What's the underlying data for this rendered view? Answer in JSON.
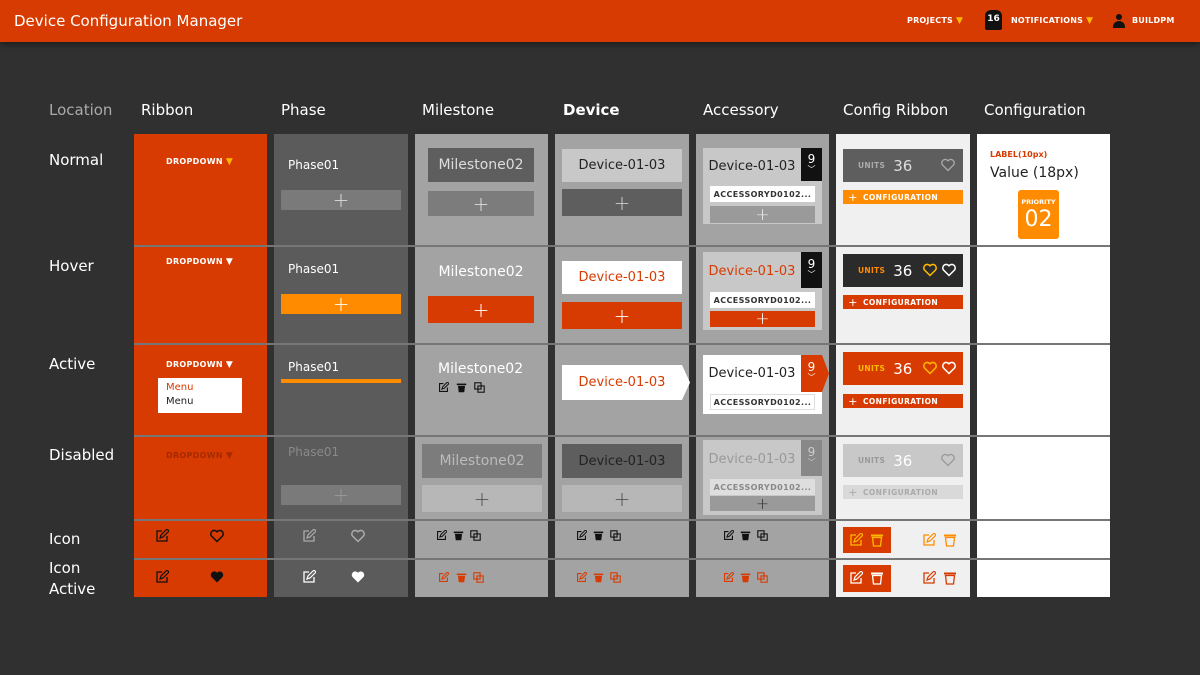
{
  "app": {
    "title": "Device Configuration Manager"
  },
  "header": {
    "projects": "PROJECTS",
    "notifications": "NOTIFICATIONS",
    "notification_count": "16",
    "user": "BUILDPM",
    "caret": "▼"
  },
  "columns": {
    "location": "Location",
    "ribbon": "Ribbon",
    "phase": "Phase",
    "milestone": "Milestone",
    "device": "Device",
    "accessory": "Accessory",
    "config_ribbon": "Config Ribbon",
    "configuration": "Configuration"
  },
  "rows": {
    "normal": "Normal",
    "hover": "Hover",
    "active": "Active",
    "disabled": "Disabled",
    "icon": "Icon",
    "icon_active_1": "Icon",
    "icon_active_2": "Active"
  },
  "ribbon": {
    "dropdown": "DROPDOWN",
    "menu_items": [
      "Menu",
      "Menu"
    ]
  },
  "phase": {
    "label": "Phase01"
  },
  "milestone": {
    "label": "Milestone02"
  },
  "device": {
    "label": "Device-01-03"
  },
  "accessory": {
    "device": "Device-01-03",
    "count": "9",
    "sub": "ACCESSORYD0102..."
  },
  "config_ribbon": {
    "units_label": "UNITS",
    "units_value": "36",
    "configuration": "CONFIGURATION"
  },
  "configuration": {
    "label": "LABEL(10px)",
    "value": "Value (18px)",
    "priority_label": "PRIORITY",
    "priority_value": "02"
  },
  "colors": {
    "accent": "#d83b01",
    "highlight": "#ff8c00",
    "background": "#303030"
  },
  "glyphs": {
    "plus": "+"
  }
}
